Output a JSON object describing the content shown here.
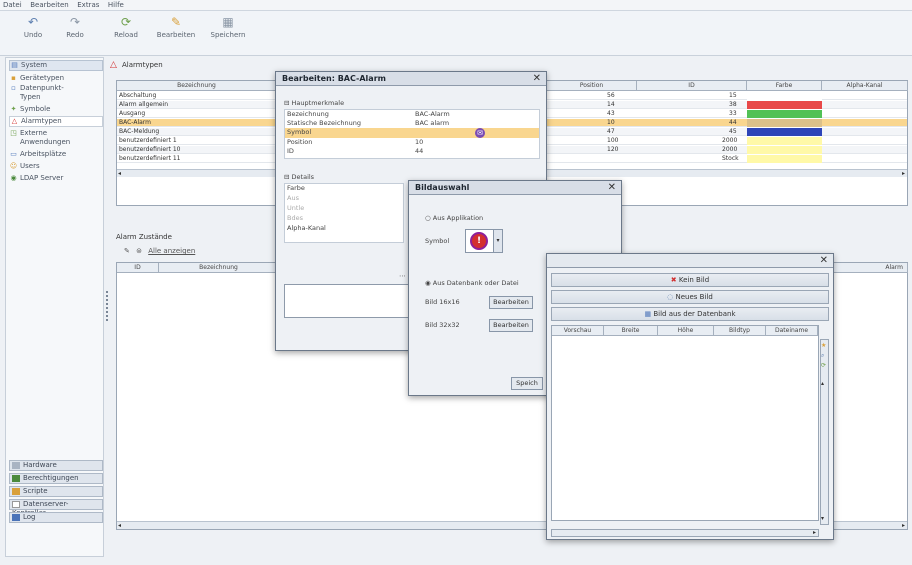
{
  "menu": [
    "Datei",
    "Bearbeiten",
    "Extras",
    "Hilfe"
  ],
  "toolbar": {
    "undo": "Undo",
    "redo": "Redo",
    "reload": "Reload",
    "edit": "Bearbeiten",
    "save": "Speichern"
  },
  "sidebar": {
    "items": [
      {
        "label": "System"
      },
      {
        "label": "Gerätetypen"
      },
      {
        "label": "Datenpunkt-"
      },
      {
        "label": "Typen"
      },
      {
        "label": "Symbole"
      },
      {
        "label": "Alarmtypen"
      },
      {
        "label": "Externe"
      },
      {
        "label": "Anwendungen"
      },
      {
        "label": "Arbeitsplätze"
      },
      {
        "label": "Users"
      },
      {
        "label": "LDAP Server"
      }
    ],
    "bottom": [
      "Hardware",
      "Berechtigungen",
      "Scripte",
      "Datenserver-Kontroller",
      "Log"
    ]
  },
  "alarm_types": {
    "title": "Alarmtypen",
    "columns": [
      "Bezeichnung",
      "Position",
      "ID",
      "Farbe",
      "Alpha-Kanal"
    ],
    "rows": [
      {
        "name": "Abschaltung",
        "pos": "56",
        "id": "15",
        "color": ""
      },
      {
        "name": "Alarm allgemein",
        "pos": "14",
        "id": "38",
        "color": "#e84848"
      },
      {
        "name": "Ausgang",
        "pos": "43",
        "id": "33",
        "color": "#52c155"
      },
      {
        "name": "BAC-Alarm",
        "pos": "10",
        "id": "44",
        "color": "#dcc18a"
      },
      {
        "name": "BAC-Meldung",
        "pos": "47",
        "id": "45",
        "color": "#2e45b8"
      },
      {
        "name": "benutzerdefiniert 1",
        "pos": "100",
        "id": "2000",
        "color": "#fff9a8"
      },
      {
        "name": "benutzerdefiniert 10",
        "pos": "120",
        "id": "2000",
        "color": "#fff9a8"
      },
      {
        "name": "benutzerdefiniert 11",
        "pos": "",
        "id": "Stock",
        "color": "#fff9a8"
      }
    ]
  },
  "alarm_states": {
    "title": "Alarm Zustände",
    "show_all": "Alle anzeigen",
    "columns": [
      "ID",
      "Bezeichnung",
      "Alarm"
    ]
  },
  "edit_dialog": {
    "title": "Bearbeiten: BAC-Alarm",
    "section_main": "Hauptmerkmale",
    "section_details": "Details",
    "props": [
      {
        "key": "Bezeichnung",
        "value": "BAC-Alarm"
      },
      {
        "key": "Statische Bezeichnung",
        "value": "BAC alarm"
      },
      {
        "key": "Symbol",
        "value": ""
      },
      {
        "key": "Position",
        "value": "10"
      },
      {
        "key": "ID",
        "value": "44"
      }
    ],
    "detail_props": [
      "Farbe",
      "Aus",
      "Untle",
      "Bdes",
      "Alpha-Kanal"
    ]
  },
  "image_dialog": {
    "title": "Bildauswahl",
    "opt_app": "Aus Applikation",
    "symbol_label": "Symbol",
    "opt_db": "Aus Datenbank oder Datei",
    "img16": "Bild 16x16",
    "img32": "Bild 32x32",
    "edit": "Bearbeiten",
    "save": "Speich"
  },
  "picker_dialog": {
    "no_image": "Kein Bild",
    "new_image": "Neues Bild",
    "from_db": "Bild aus der Datenbank",
    "columns": [
      "Vorschau",
      "Breite",
      "Höhe",
      "Bildtyp",
      "Dateiname"
    ]
  },
  "colors": {
    "accent": "#f9d68f",
    "alarm_red": "#e84848",
    "green": "#52c155",
    "blue": "#2e45b8",
    "yellow": "#fff9a8"
  }
}
